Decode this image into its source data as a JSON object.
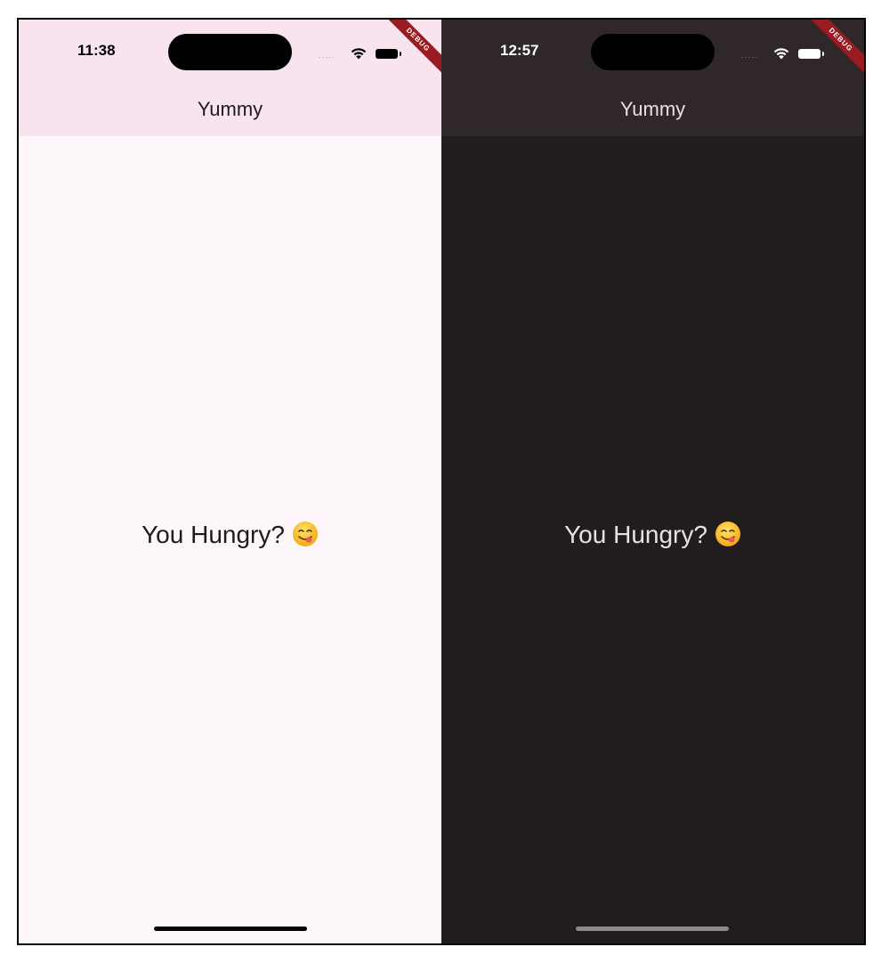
{
  "screens": [
    {
      "theme": "light",
      "status_time": "11:38",
      "signal_dots": ".....",
      "debug_label": "DEBUG",
      "appbar_title": "Yummy",
      "message": "You Hungry?",
      "emoji_icon": "face-savoring-food-icon"
    },
    {
      "theme": "dark",
      "status_time": "12:57",
      "signal_dots": ".....",
      "debug_label": "DEBUG",
      "appbar_title": "Yummy",
      "message": "You Hungry?",
      "emoji_icon": "face-savoring-food-icon"
    }
  ],
  "colors": {
    "light_background": "#fdf7fb",
    "light_appbar": "#f7e4ee",
    "dark_background": "#211d1f",
    "dark_appbar": "#2f2729",
    "debug_ribbon": "#9b1b22"
  }
}
